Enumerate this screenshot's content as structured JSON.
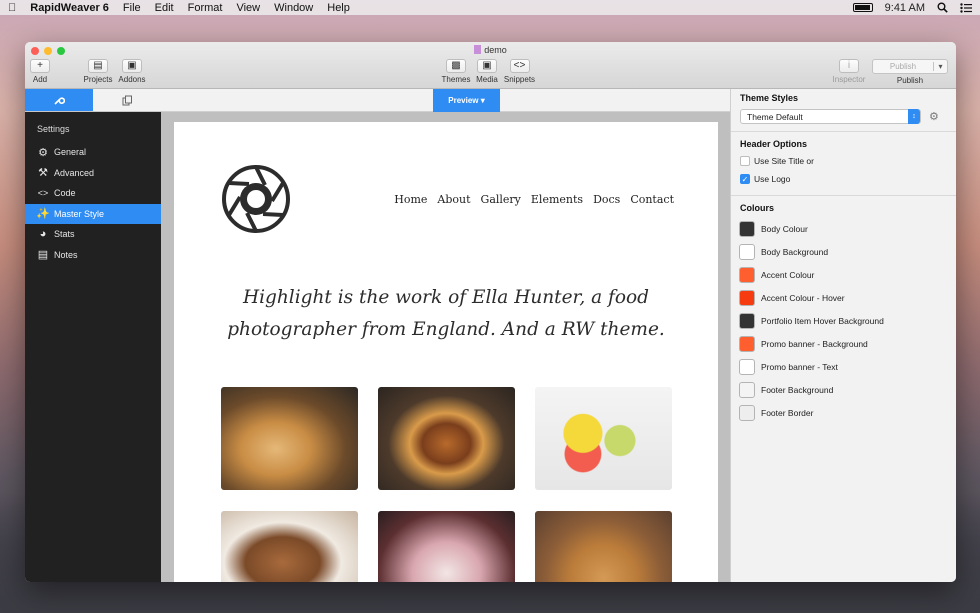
{
  "menubar": {
    "app_name": "RapidWeaver 6",
    "menus": [
      "File",
      "Edit",
      "Format",
      "View",
      "Window",
      "Help"
    ],
    "time": "9:41 AM"
  },
  "window": {
    "title": "demo",
    "toolbar": {
      "add": "Add",
      "projects": "Projects",
      "addons": "Addons",
      "themes": "Themes",
      "media": "Media",
      "snippets": "Snippets",
      "inspector": "Inspector",
      "publish_button": "Publish",
      "publish": "Publish"
    }
  },
  "sidebar": {
    "heading": "Settings",
    "items": [
      {
        "label": "General",
        "icon": "gear-icon"
      },
      {
        "label": "Advanced",
        "icon": "hammer-icon"
      },
      {
        "label": "Code",
        "icon": "code-icon"
      },
      {
        "label": "Master Style",
        "icon": "magic-wand-icon",
        "active": true
      },
      {
        "label": "Stats",
        "icon": "stats-icon"
      },
      {
        "label": "Notes",
        "icon": "notes-icon"
      }
    ]
  },
  "preview": {
    "button": "Preview",
    "nav": [
      "Home",
      "About",
      "Gallery",
      "Elements",
      "Docs",
      "Contact"
    ],
    "tagline_1": "Highlight is the work of Ella Hunter, a food",
    "tagline_2": "photographer from England. And a RW theme."
  },
  "inspector": {
    "theme_styles_heading": "Theme Styles",
    "theme_select": "Theme Default",
    "header_options_heading": "Header Options",
    "options": [
      {
        "label": "Use Site Title or",
        "checked": false
      },
      {
        "label": "Use Logo",
        "checked": true
      }
    ],
    "colours_heading": "Colours",
    "colours": [
      {
        "label": "Body Colour",
        "color": "#333333"
      },
      {
        "label": "Body Background",
        "color": "#ffffff"
      },
      {
        "label": "Accent Colour",
        "color": "#ff5e2f"
      },
      {
        "label": "Accent Colour - Hover",
        "color": "#f53b0f"
      },
      {
        "label": "Portfolio Item Hover Background",
        "color": "#333333"
      },
      {
        "label": "Promo banner - Background",
        "color": "#ff5e2f"
      },
      {
        "label": "Promo banner - Text",
        "color": "#ffffff"
      },
      {
        "label": "Footer Background",
        "color": "#f4f4f4"
      },
      {
        "label": "Footer Border",
        "color": "#eeeeee"
      }
    ]
  },
  "colors": {
    "accent": "#2f8cf3",
    "sidebar_bg": "#212121"
  }
}
